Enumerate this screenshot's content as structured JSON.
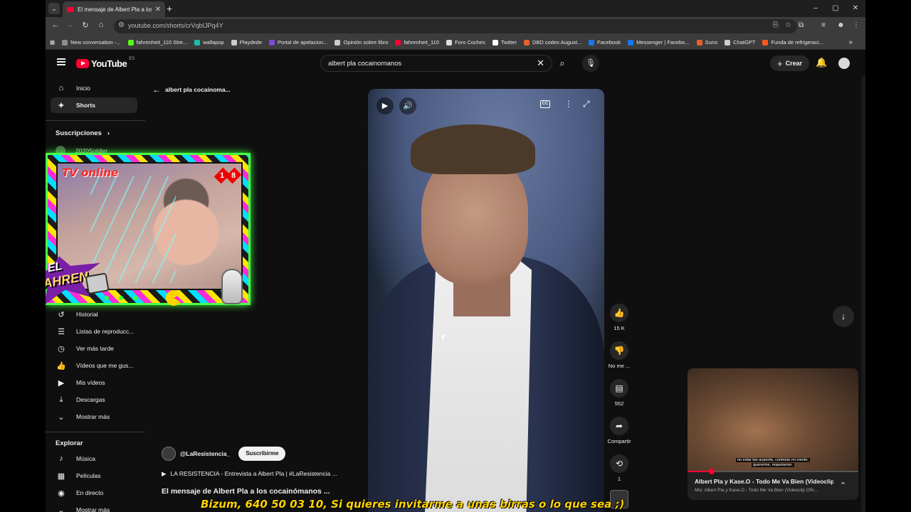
{
  "browser": {
    "tab_title": "El mensaje de Albert Pla a los c",
    "url": "youtube.com/shorts/crVqbIJPq4Y",
    "window_controls": [
      "–",
      "▢",
      "✕"
    ]
  },
  "bookmarks": [
    {
      "label": "New conversation -...",
      "color": "#8e8e8e"
    },
    {
      "label": "fahrenheit_110 Stre...",
      "color": "#53fc18"
    },
    {
      "label": "wallapop",
      "color": "#13c1ac"
    },
    {
      "label": "Playdede",
      "color": "#cccccc"
    },
    {
      "label": "Portal de apelacion...",
      "color": "#7b4bd8"
    },
    {
      "label": "Opinión sobre libro",
      "color": "#cccccc"
    },
    {
      "label": "fahrenheit_110",
      "color": "#ff0033"
    },
    {
      "label": "Foro Coches",
      "color": "#dddddd"
    },
    {
      "label": "Twitter",
      "color": "#ffffff"
    },
    {
      "label": "DBD codes August...",
      "color": "#e8612c"
    },
    {
      "label": "Facebook",
      "color": "#1877f2"
    },
    {
      "label": "Messenger | Facebo...",
      "color": "#1877f2"
    },
    {
      "label": "Suno",
      "color": "#e8612c"
    },
    {
      "label": "ChatGPT",
      "color": "#cccccc"
    },
    {
      "label": "Funda de refrigeraci...",
      "color": "#ff5722"
    }
  ],
  "youtube": {
    "logo_text": "YouTube",
    "region": "ES",
    "search_query": "albert pla cocainomanos",
    "create_label": "Crear"
  },
  "sidebar": {
    "items": [
      {
        "label": "Inicio",
        "icon": "home-icon",
        "glyph": "⌂"
      },
      {
        "label": "Shorts",
        "icon": "shorts-icon",
        "glyph": "✦"
      }
    ],
    "subscriptions_heading": "Suscripciones",
    "subscription_first": "2020Soldier",
    "library_items": [
      {
        "label": "Historial",
        "icon": "history-icon",
        "glyph": "↺"
      },
      {
        "label": "Listas de reproducc...",
        "icon": "playlist-icon",
        "glyph": "☰"
      },
      {
        "label": "Ver más tarde",
        "icon": "clock-icon",
        "glyph": "◷"
      },
      {
        "label": "Vídeos que me gus...",
        "icon": "thumbs-up-icon",
        "glyph": "👍"
      },
      {
        "label": "Mis vídeos",
        "icon": "my-videos-icon",
        "glyph": "▶"
      },
      {
        "label": "Descargas",
        "icon": "download-icon",
        "glyph": "⤓"
      },
      {
        "label": "Mostrar más",
        "icon": "chevron-down-icon",
        "glyph": "⌄"
      }
    ],
    "explore_heading": "Explorar",
    "explore_items": [
      {
        "label": "Música",
        "icon": "music-icon",
        "glyph": "♪"
      },
      {
        "label": "Películas",
        "icon": "film-icon",
        "glyph": "▦"
      },
      {
        "label": "En directo",
        "icon": "live-icon",
        "glyph": "◉"
      },
      {
        "label": "Mostrar más",
        "icon": "chevron-down-icon",
        "glyph": "⌄"
      }
    ]
  },
  "overlay": {
    "title": "TV online",
    "age": [
      "1",
      "8"
    ],
    "logo_line1": "EL",
    "logo_line2": "FAHREN"
  },
  "shorts": {
    "back_label": "albert pla cocainoma...",
    "likes": "15 K",
    "dislike_label": "No me ...",
    "comments": "552",
    "share_label": "Compartir",
    "remix_count": "1",
    "channel": "@LaResistencia_",
    "subscribe_label": "Suscribirme",
    "related_video": "LA RESISTENCIA - Entrevista a Albert Pla | #LaResistencia ...",
    "title": "El mensaje de Albert Pla a los cocainómanos ..."
  },
  "miniplayer": {
    "subtitle_line1": "no estar tan ausente, controlar mi mente,",
    "subtitle_line2": "quererme, respetarme.",
    "title": "Albert Pla y Kase.O - Todo Me Va Bien (Videoclip...",
    "meta": "Mix: Albert Pla y Kase.O - Todo Me Va Bien (Videoclip Ofic...",
    "progress": 0.14
  },
  "ticker": "Bizum, 640 50 03 10, Si quieres invitarme a unas birras o lo que sea ;)"
}
